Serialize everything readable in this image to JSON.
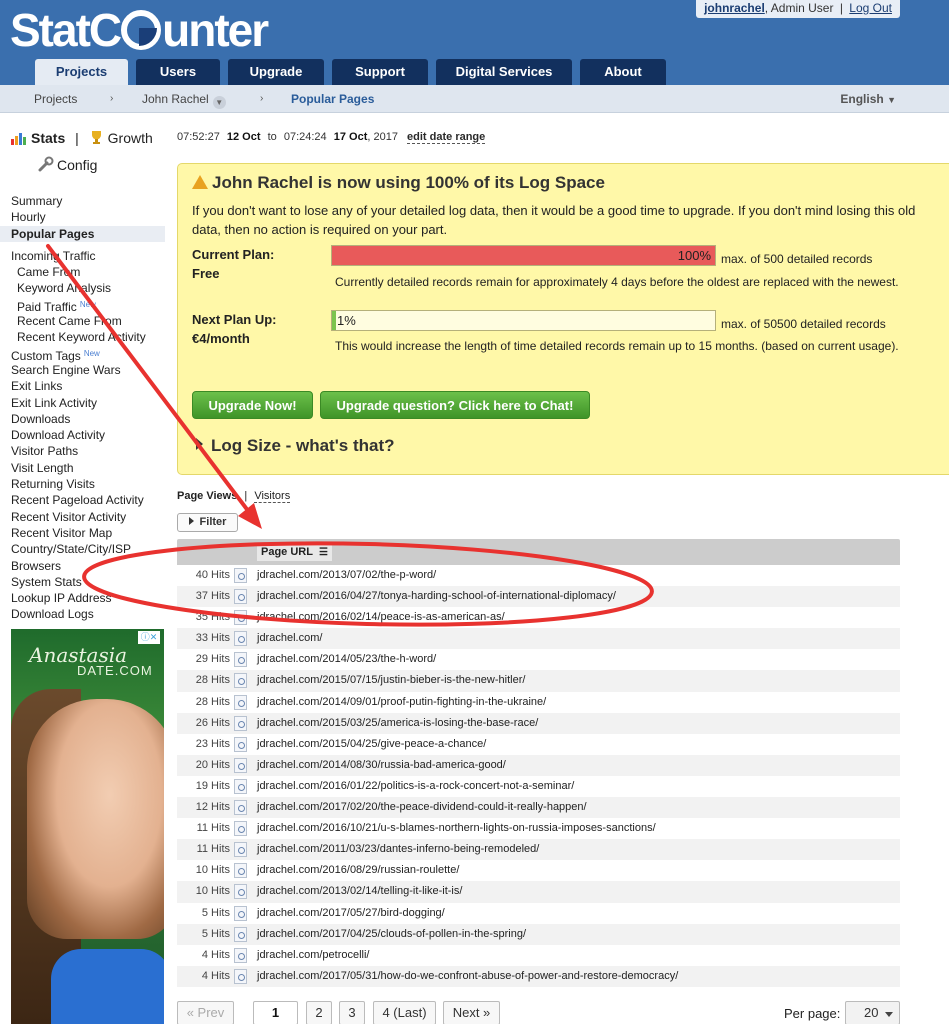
{
  "header": {
    "logo": {
      "part1": "Stat",
      "part2": "unter",
      "prefix_c": "C"
    },
    "user": {
      "name": "johnrachel",
      "role": ", Admin User",
      "sep": "|",
      "logout": "Log Out"
    },
    "tabs": [
      {
        "label": "Projects",
        "active": true
      },
      {
        "label": "Users"
      },
      {
        "label": "Upgrade"
      },
      {
        "label": "Support"
      },
      {
        "label": "Digital Services"
      },
      {
        "label": "About"
      }
    ]
  },
  "breadcrumb": {
    "items": [
      "Projects",
      "John Rachel",
      "Popular Pages"
    ],
    "sep": "›",
    "language": "English"
  },
  "sidebar": {
    "stats": "Stats",
    "divider": "|",
    "growth": "Growth",
    "config": "Config",
    "items": [
      {
        "label": "Summary"
      },
      {
        "label": "Hourly"
      },
      {
        "label": "Popular Pages",
        "active": true
      },
      {
        "label": "Incoming Traffic"
      },
      {
        "label": "Came From",
        "sub": true
      },
      {
        "label": "Keyword Analysis",
        "sub": true
      },
      {
        "label": "Paid Traffic",
        "sub": true,
        "badge": "New"
      },
      {
        "label": "Recent Came From",
        "sub": true
      },
      {
        "label": "Recent Keyword Activity",
        "sub": true
      },
      {
        "label": "Custom Tags",
        "badge": "New"
      },
      {
        "label": "Search Engine Wars"
      },
      {
        "label": "Exit Links"
      },
      {
        "label": "Exit Link Activity"
      },
      {
        "label": "Downloads"
      },
      {
        "label": "Download Activity"
      },
      {
        "label": "Visitor Paths"
      },
      {
        "label": "Visit Length"
      },
      {
        "label": "Returning Visits"
      },
      {
        "label": "Recent Pageload Activity"
      },
      {
        "label": "Recent Visitor Activity"
      },
      {
        "label": "Recent Visitor Map"
      },
      {
        "label": "Country/State/City/ISP"
      },
      {
        "label": "Browsers"
      },
      {
        "label": "System Stats"
      },
      {
        "label": "Lookup IP Address"
      },
      {
        "label": "Download Logs"
      }
    ],
    "ad": {
      "brand1": "Anastasia",
      "brand2": "DATE.COM"
    }
  },
  "daterange": {
    "from_time": "07:52:27",
    "from_date": "12 Oct",
    "to": "to",
    "to_time": "07:24:24",
    "to_date": "17 Oct",
    "year": ", 2017",
    "edit": "edit date range"
  },
  "notice": {
    "title": "John Rachel is now using 100% of its Log Space",
    "message": "If you don't want to lose any of your detailed log data, then it would be a good time to upgrade. If you don't mind losing this old data, then no action is required on your part.",
    "current": {
      "label": "Current Plan:",
      "plan": "Free",
      "percent_label": "100%",
      "percent": 100,
      "max": "max. of 500 detailed records",
      "note": "Currently detailed records remain for approximately 4 days before the oldest are replaced with the newest."
    },
    "next": {
      "label": "Next Plan Up:",
      "plan": "€4/month",
      "percent_label": "1%",
      "percent": 1,
      "max": "max. of 50500 detailed records",
      "note": "This would increase the length of time detailed records remain up to 15 months. (based on current usage)."
    },
    "upgrade_btn": "Upgrade Now!",
    "chat_btn": "Upgrade question? Click here to Chat!",
    "logsize": "Log Size - what's that?"
  },
  "views": {
    "page_views": "Page Views",
    "sep": "|",
    "visitors": "Visitors"
  },
  "filter": "Filter",
  "table": {
    "header": "Page URL",
    "rows": [
      {
        "hits": "40 Hits",
        "url": "jdrachel.com/2013/07/02/the-p-word/"
      },
      {
        "hits": "37 Hits",
        "url": "jdrachel.com/2016/04/27/tonya-harding-school-of-international-diplomacy/"
      },
      {
        "hits": "35 Hits",
        "url": "jdrachel.com/2016/02/14/peace-is-as-american-as/"
      },
      {
        "hits": "33 Hits",
        "url": "jdrachel.com/"
      },
      {
        "hits": "29 Hits",
        "url": "jdrachel.com/2014/05/23/the-h-word/"
      },
      {
        "hits": "28 Hits",
        "url": "jdrachel.com/2015/07/15/justin-bieber-is-the-new-hitler/"
      },
      {
        "hits": "28 Hits",
        "url": "jdrachel.com/2014/09/01/proof-putin-fighting-in-the-ukraine/"
      },
      {
        "hits": "26 Hits",
        "url": "jdrachel.com/2015/03/25/america-is-losing-the-base-race/"
      },
      {
        "hits": "23 Hits",
        "url": "jdrachel.com/2015/04/25/give-peace-a-chance/"
      },
      {
        "hits": "20 Hits",
        "url": "jdrachel.com/2014/08/30/russia-bad-america-good/"
      },
      {
        "hits": "19 Hits",
        "url": "jdrachel.com/2016/01/22/politics-is-a-rock-concert-not-a-seminar/"
      },
      {
        "hits": "12 Hits",
        "url": "jdrachel.com/2017/02/20/the-peace-dividend-could-it-really-happen/"
      },
      {
        "hits": "11 Hits",
        "url": "jdrachel.com/2016/10/21/u-s-blames-northern-lights-on-russia-imposes-sanctions/"
      },
      {
        "hits": "11 Hits",
        "url": "jdrachel.com/2011/03/23/dantes-inferno-being-remodeled/"
      },
      {
        "hits": "10 Hits",
        "url": "jdrachel.com/2016/08/29/russian-roulette/"
      },
      {
        "hits": "10 Hits",
        "url": "jdrachel.com/2013/02/14/telling-it-like-it-is/"
      },
      {
        "hits": "5 Hits",
        "url": "jdrachel.com/2017/05/27/bird-dogging/"
      },
      {
        "hits": "5 Hits",
        "url": "jdrachel.com/2017/04/25/clouds-of-pollen-in-the-spring/"
      },
      {
        "hits": "4 Hits",
        "url": "jdrachel.com/petrocelli/"
      },
      {
        "hits": "4 Hits",
        "url": "jdrachel.com/2017/05/31/how-do-we-confront-abuse-of-power-and-restore-democracy/"
      }
    ]
  },
  "pager": {
    "prev": "« Prev",
    "pages": [
      "1",
      "2",
      "3",
      "4 (Last)"
    ],
    "next": "Next »",
    "per_page_label": "Per page:",
    "per_page": "20"
  },
  "colors": {
    "header_blue": "#3a6fae",
    "tab_dark": "#12305e",
    "notice_yellow": "#fff8a8",
    "bar_full_red": "#e85a5a",
    "bar_next_green": "#7cc44e",
    "annotation_red": "#e8322f"
  }
}
